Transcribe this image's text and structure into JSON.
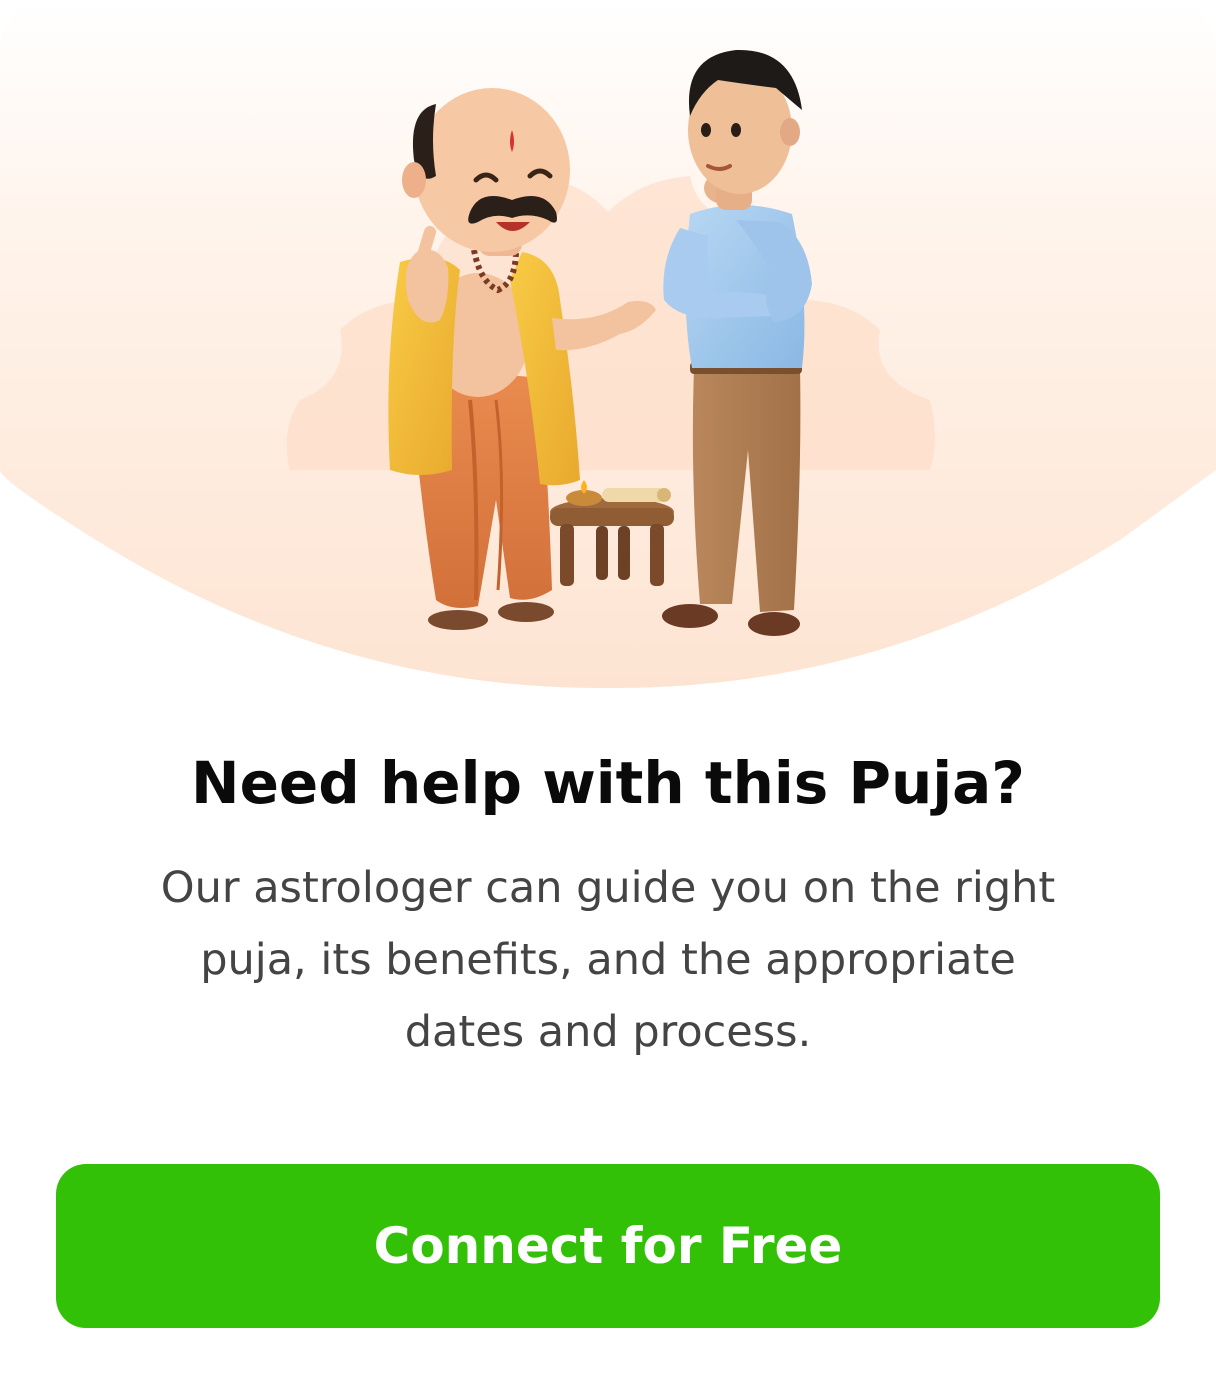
{
  "help_card": {
    "title": "Need help with this Puja?",
    "description_lines": [
      "Our astrologer can guide you on the right",
      "puja, its benefits, and the appropriate",
      "dates and process."
    ],
    "cta_label": "Connect for Free"
  },
  "colors": {
    "cta_green": "#33c107",
    "hero_peach": "#fde6d6",
    "title_text": "#0a0a0a",
    "body_text": "#444444"
  },
  "icons": {
    "hero_illustration": "astrologer-guiding-man-illustration"
  }
}
